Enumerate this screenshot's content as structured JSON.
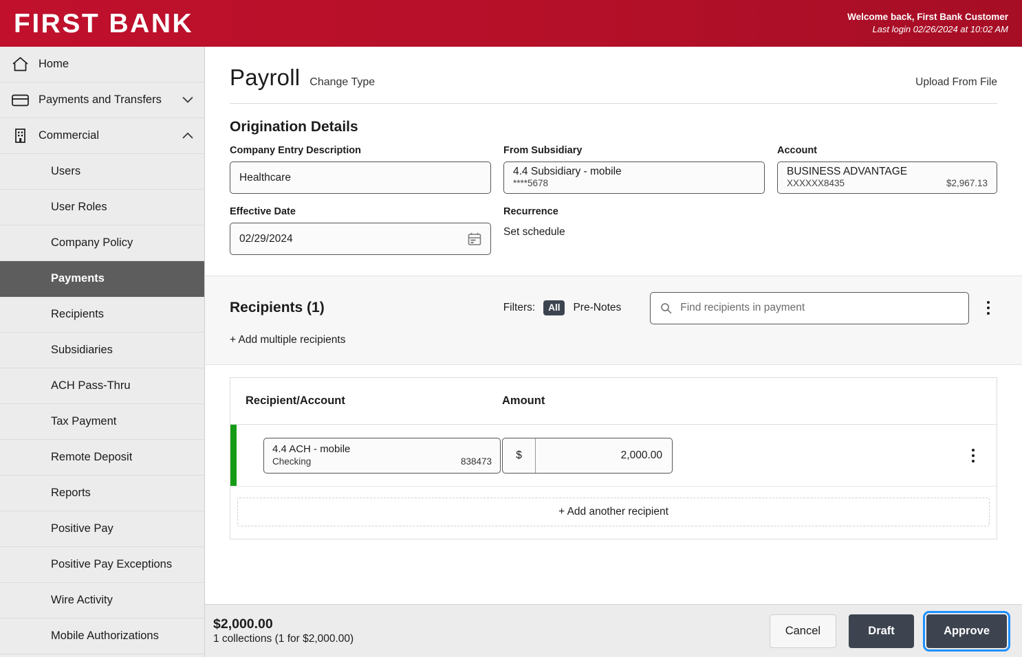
{
  "header": {
    "brand": "FIRST BANK",
    "welcome_line": "Welcome back, First Bank Customer",
    "last_login_line": "Last login 02/26/2024 at 10:02 AM"
  },
  "sidebar": {
    "top_items": [
      {
        "label": "Home",
        "icon": "home-icon",
        "chevron": ""
      },
      {
        "label": "Payments and Transfers",
        "icon": "card-icon",
        "chevron": "∨"
      },
      {
        "label": "Commercial",
        "icon": "building-icon",
        "chevron": "∧"
      }
    ],
    "sub_items": [
      {
        "label": "Users",
        "active": false
      },
      {
        "label": "User Roles",
        "active": false
      },
      {
        "label": "Company Policy",
        "active": false
      },
      {
        "label": "Payments",
        "active": true
      },
      {
        "label": "Recipients",
        "active": false
      },
      {
        "label": "Subsidiaries",
        "active": false
      },
      {
        "label": "ACH Pass-Thru",
        "active": false
      },
      {
        "label": "Tax Payment",
        "active": false
      },
      {
        "label": "Remote Deposit",
        "active": false
      },
      {
        "label": "Reports",
        "active": false
      },
      {
        "label": "Positive Pay",
        "active": false
      },
      {
        "label": "Positive Pay Exceptions",
        "active": false
      },
      {
        "label": "Wire Activity",
        "active": false
      },
      {
        "label": "Mobile Authorizations",
        "active": false
      }
    ]
  },
  "page": {
    "title": "Payroll",
    "change_type": "Change Type",
    "upload_from_file": "Upload From File"
  },
  "origination": {
    "section_title": "Origination Details",
    "company_entry_description": {
      "label": "Company Entry Description",
      "value": "Healthcare"
    },
    "from_subsidiary": {
      "label": "From Subsidiary",
      "value": "4.4 Subsidiary - mobile",
      "sub": "****5678"
    },
    "account": {
      "label": "Account",
      "value": "BUSINESS ADVANTAGE",
      "number": "XXXXXX8435",
      "balance": "$2,967.13"
    },
    "effective_date": {
      "label": "Effective Date",
      "value": "02/29/2024"
    },
    "recurrence": {
      "label": "Recurrence",
      "value": "Set schedule"
    }
  },
  "recipients_panel": {
    "title": "Recipients (1)",
    "filters_label": "Filters:",
    "filter_all": "All",
    "filter_pre_notes": "Pre-Notes",
    "search_placeholder": "Find recipients in payment",
    "search_value": "",
    "add_multiple": "+ Add multiple recipients"
  },
  "table": {
    "columns": [
      "Recipient/Account",
      "Amount"
    ],
    "rows": [
      {
        "recipient_name": "4.4 ACH - mobile",
        "account_type": "Checking",
        "account_number": "838473",
        "currency_symbol": "$",
        "amount": "2,000.00",
        "status_color": "#169b16"
      }
    ],
    "add_another": "+ Add another recipient"
  },
  "footer": {
    "total": "$2,000.00",
    "summary": "1 collections (1 for $2,000.00)",
    "cancel_label": "Cancel",
    "draft_label": "Draft",
    "approve_label": "Approve",
    "approve_focus_color": "#1e90ff"
  }
}
